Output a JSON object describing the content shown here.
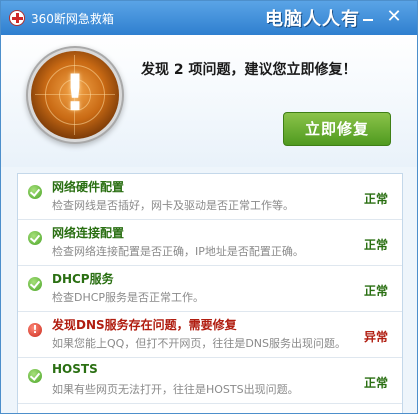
{
  "window": {
    "title": "360断网急救箱",
    "watermark": "电脑人人有",
    "minimize_label": "",
    "close_label": "✕"
  },
  "header": {
    "summary": "发现 2 项问题，建议您立即修复！",
    "alert_mark": "!",
    "fix_button_label": "立即修复"
  },
  "items": [
    {
      "title": "网络硬件配置",
      "desc": "检查网线是否插好，网卡及驱动是否正常工作等。",
      "status": "正常",
      "state": "ok"
    },
    {
      "title": "网络连接配置",
      "desc": "检查网络连接配置是否正确，IP地址是否配置正确。",
      "status": "正常",
      "state": "ok"
    },
    {
      "title": "DHCP服务",
      "desc": "检查DHCP服务是否正常工作。",
      "status": "正常",
      "state": "ok"
    },
    {
      "title": "发现DNS服务存在问题，需要修复",
      "desc": "如果您能上QQ，但打不开网页，往往是DNS服务出现问题。",
      "status": "异常",
      "state": "error"
    },
    {
      "title": "HOSTS",
      "desc": "如果有些网页无法打开，往往是HOSTS出现问题。",
      "status": "正常",
      "state": "ok"
    }
  ],
  "colors": {
    "ok": "#2a6f12",
    "error": "#b01d10",
    "titlebar": "#3a88d6",
    "fix_button": "#5fa82a"
  }
}
